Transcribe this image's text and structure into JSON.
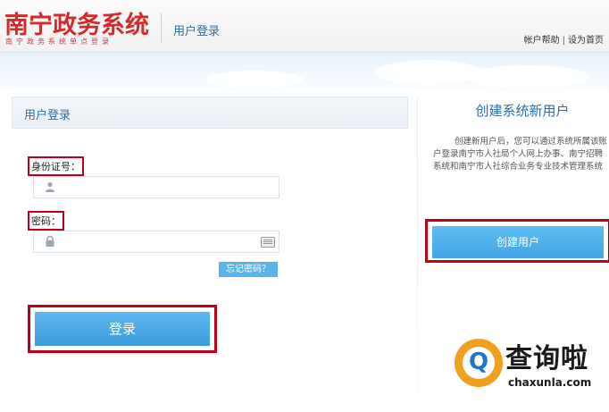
{
  "header": {
    "logo_title": "南宁政务系统",
    "logo_subtitle": "南宁政务系统单点登录",
    "page_title": "用户登录",
    "links": {
      "help": "帐户帮助",
      "separator": "|",
      "homepage": "设为首页"
    }
  },
  "login": {
    "panel_title": "用户登录",
    "id_label": "身份证号：",
    "id_value": "",
    "password_label": "密码：",
    "password_value": "",
    "forgot_label": "忘记密码？",
    "login_button": "登录"
  },
  "register": {
    "title": "创建系统新用户",
    "description": "创建新用户后，您可以通过系统所属该账户登录南宁市人社局个人网上办事、南宁招聘系统和南宁市人社综合业务专业技术管理系统",
    "create_button": "创建用户"
  },
  "watermark": {
    "logo_letter": "Q",
    "title": "查询啦",
    "url": "chaxunla.com"
  },
  "colors": {
    "brand_red": "#d52a2a",
    "accent_blue": "#3d9bdd",
    "highlight_red": "#c0001a"
  }
}
